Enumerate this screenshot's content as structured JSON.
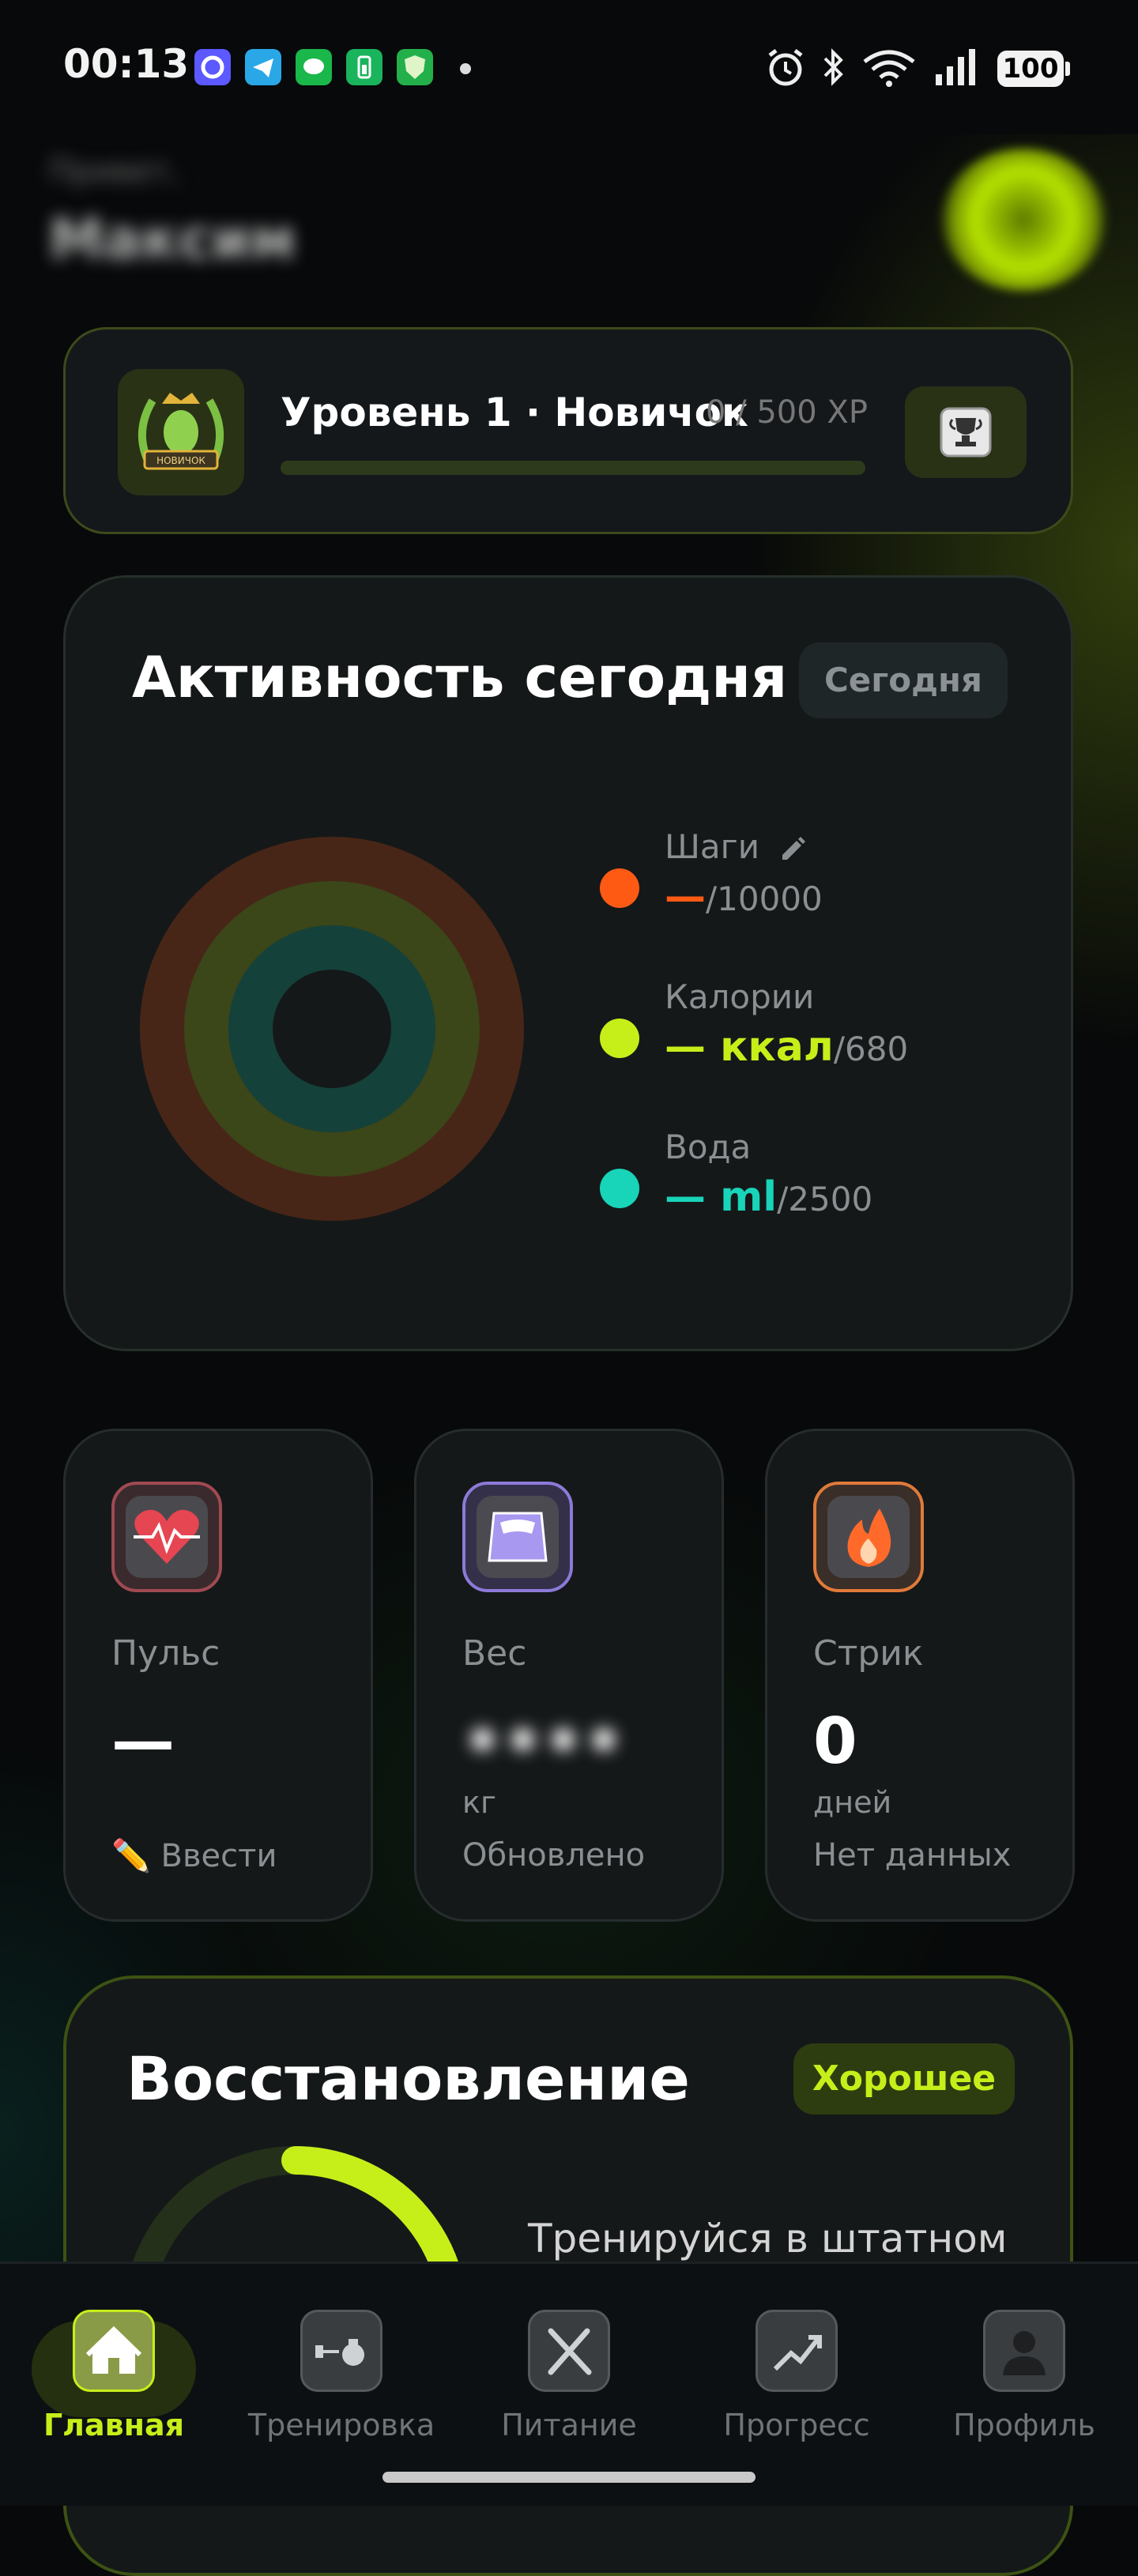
{
  "status_bar": {
    "time": "00:13",
    "battery": "100",
    "notification_icons": [
      "messenger-icon",
      "telegram-icon",
      "chat-icon",
      "battery-saver-icon",
      "shield-icon"
    ],
    "system_icons": [
      "alarm-icon",
      "bluetooth-icon",
      "wifi-icon",
      "signal-icon"
    ]
  },
  "header": {
    "greeting": "Привет,",
    "user_name": "Максим"
  },
  "level": {
    "title": "Уровень 1 · Новичок",
    "xp": "0 / 500 XP",
    "progress": 0,
    "badge_text": "НОВИЧОК"
  },
  "activity": {
    "title": "Активность сегодня",
    "period_button": "Сегодня",
    "items": [
      {
        "label": "Шаги",
        "value": "—",
        "goal": "/10000",
        "color": "#ff5a14",
        "progress": 0
      },
      {
        "label": "Калории",
        "value": "— ккал",
        "goal": "/680",
        "color": "#c6ef1a",
        "progress": 0
      },
      {
        "label": "Вода",
        "value": "— ml",
        "goal": "/2500",
        "color": "#18d4b8",
        "progress": 0
      }
    ]
  },
  "stats": {
    "pulse": {
      "label": "Пульс",
      "value": "—",
      "action": "Ввести"
    },
    "weight": {
      "label": "Вес",
      "value": "••••",
      "unit": "кг",
      "footer": "Обновлено"
    },
    "streak": {
      "label": "Стрик",
      "value": "0",
      "unit": "дней",
      "footer": "Нет данных"
    }
  },
  "recovery": {
    "title": "Восстановление",
    "status": "Хорошее",
    "text": "Тренируйся в штатном",
    "progress": 0.3,
    "color": "#c6ef1a"
  },
  "nav": {
    "items": [
      {
        "label": "Главная",
        "icon": "home-icon",
        "active": true
      },
      {
        "label": "Тренировка",
        "icon": "dumbbell-icon",
        "active": false
      },
      {
        "label": "Питание",
        "icon": "cutlery-icon",
        "active": false
      },
      {
        "label": "Прогресс",
        "icon": "chart-icon",
        "active": false
      },
      {
        "label": "Профиль",
        "icon": "profile-icon",
        "active": false
      }
    ]
  }
}
